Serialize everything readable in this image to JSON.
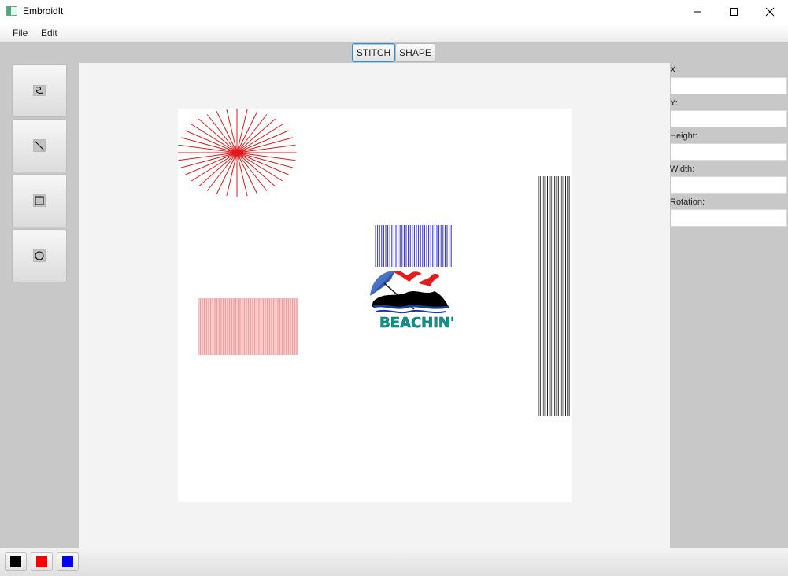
{
  "window": {
    "title": "EmbroidIt"
  },
  "menu": {
    "file": "File",
    "edit": "Edit"
  },
  "mode_toggle": {
    "stitch": "STITCH",
    "shape": "SHAPE",
    "active": "STITCH"
  },
  "tools": [
    {
      "name": "freehand-tool",
      "icon": "squiggle-icon"
    },
    {
      "name": "line-tool",
      "icon": "diagonal-line-icon"
    },
    {
      "name": "rectangle-tool",
      "icon": "square-icon"
    },
    {
      "name": "ellipse-tool",
      "icon": "circle-icon"
    }
  ],
  "properties": {
    "x_label": "X:",
    "x_value": "",
    "y_label": "Y:",
    "y_value": "",
    "height_label": "Height:",
    "height_value": "",
    "width_label": "Width:",
    "width_value": "",
    "rotation_label": "Rotation:",
    "rotation_value": ""
  },
  "canvas": {
    "starburst_color": "#e01818",
    "blue_stitch_color": "#2a2ad0",
    "red_stitch_color": "#f09090",
    "black_stitch_color": "#222222",
    "logo_text": "BEACHIN'"
  },
  "palette": [
    {
      "name": "black",
      "color": "#000000"
    },
    {
      "name": "red",
      "color": "#ff0000"
    },
    {
      "name": "blue",
      "color": "#0000ff"
    }
  ]
}
